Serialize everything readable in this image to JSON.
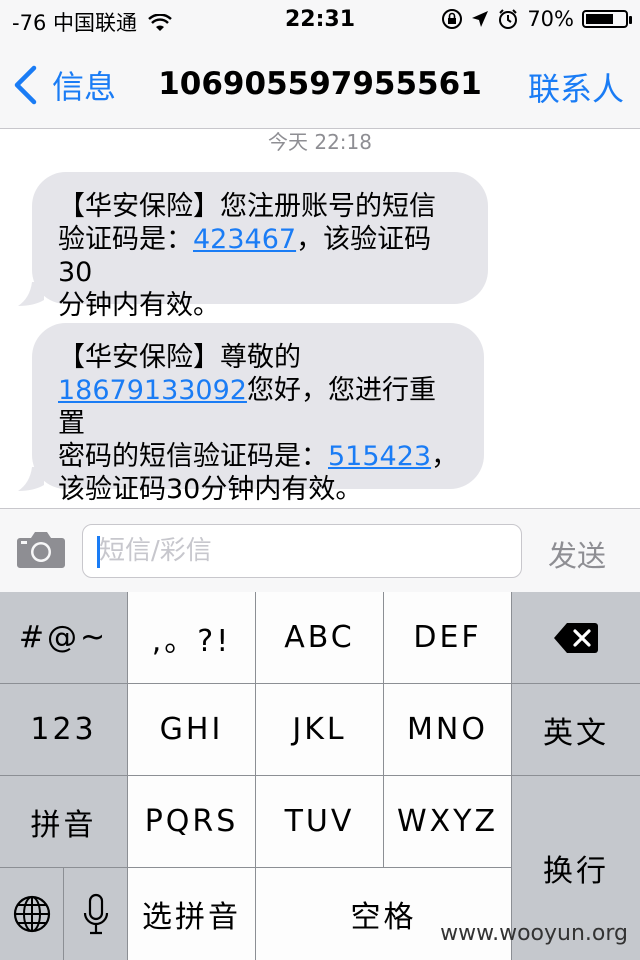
{
  "status_bar": {
    "signal": "-76",
    "carrier": "中国联通",
    "time": "22:31",
    "battery_percent": 70,
    "battery_label": "70%"
  },
  "nav": {
    "back_label": "信息",
    "title": "106905597955561",
    "right_label": "联系人"
  },
  "conversation": {
    "timestamp": "今天 22:18",
    "messages": [
      {
        "text_1": "【华安保险】您注册账号的短信",
        "text_2": "验证码是：",
        "code": "423467",
        "text_3": "，该验证码30",
        "text_4": "分钟内有效。"
      },
      {
        "text_1": "【华安保险】尊敬的",
        "phone": "18679133092",
        "text_2": "您好，您进行重置",
        "text_3": "密码的短信验证码是：",
        "code": "515423",
        "text_4": "，",
        "text_5": "该验证码30分钟内有效。"
      }
    ]
  },
  "input_bar": {
    "placeholder": "短信/彩信",
    "send_label": "发送"
  },
  "keyboard": {
    "symbols": "#@~",
    "punct": ",。?!",
    "abc": "ABC",
    "def": "DEF",
    "num": "123",
    "ghi": "GHI",
    "jkl": "JKL",
    "mno": "MNO",
    "english": "英文",
    "pinyin": "拼音",
    "pqrs": "PQRS",
    "tuv": "TUV",
    "wxyz": "WXYZ",
    "return": "换行",
    "select_pinyin": "选拼音",
    "space": "空格"
  },
  "watermark": "www.wooyun.org",
  "colors": {
    "accent": "#1a7cf5",
    "bubble": "#e5e5ea",
    "keyboard_bg": "#8c8f94"
  }
}
